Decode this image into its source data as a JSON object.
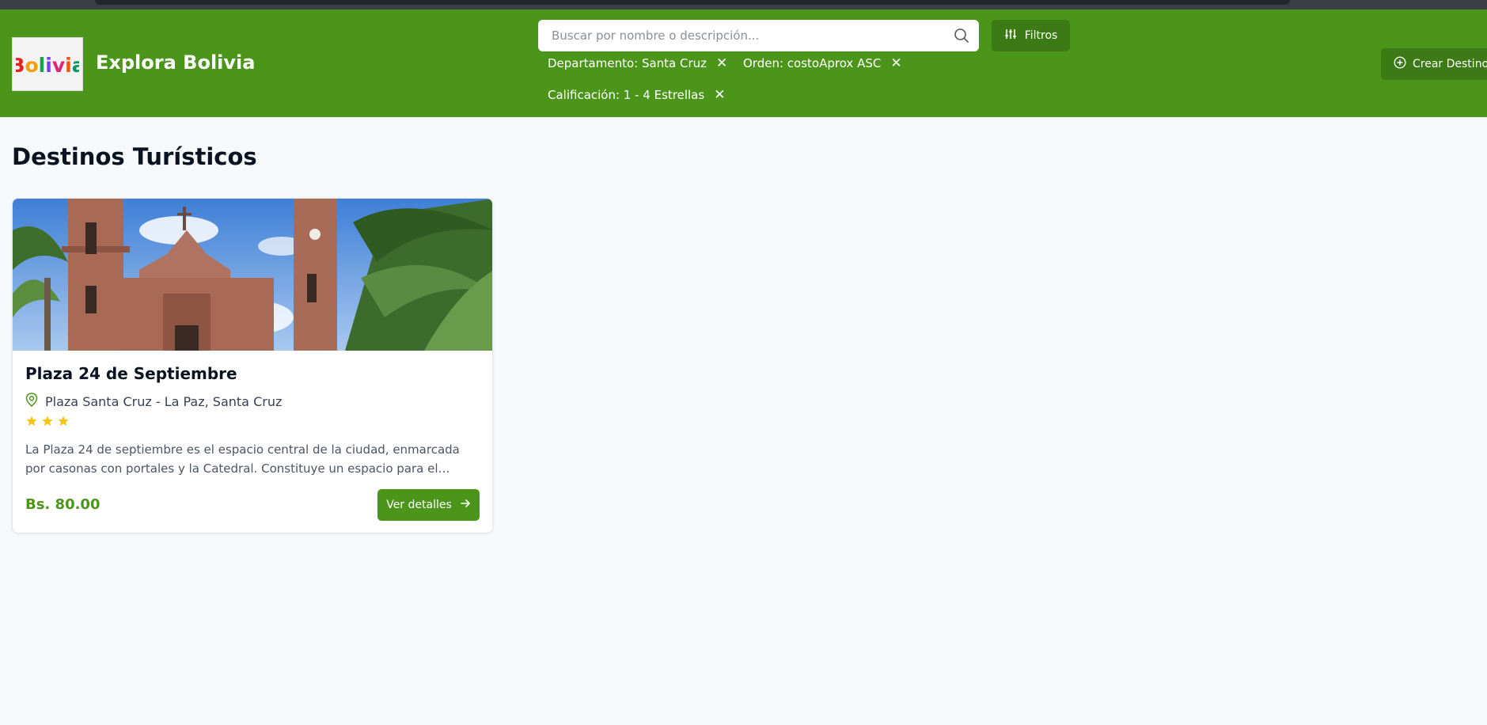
{
  "header": {
    "logo_text": "Bolivia",
    "brand_title": "Explora Bolivia",
    "search": {
      "placeholder": "Buscar por nombre o descripción..."
    },
    "filters_label": "Filtros",
    "active_filters": [
      {
        "label": "Departamento: Santa Cruz"
      },
      {
        "label": "Orden: costoAprox ASC"
      },
      {
        "label": "Calificación: 1 - 4 Estrellas"
      }
    ],
    "create_label": "Crear Destino"
  },
  "main": {
    "page_title": "Destinos Turísticos",
    "destinations": [
      {
        "name": "Plaza 24 de Septiembre",
        "location": "Plaza Santa Cruz - La Paz, Santa Cruz",
        "rating": 3,
        "description": "La Plaza 24 de septiembre es el espacio central de la ciudad, enmarcada por casonas con portales y la Catedral. Constituye un espacio para el esparcimiento...",
        "price": "Bs. 80.00",
        "details_label": "Ver detalles",
        "image": "cathedral-plaza-photo"
      }
    ]
  },
  "icons": {
    "search": "search-icon",
    "filters": "sliders-icon",
    "remove": "close-icon",
    "create": "plus-circle-icon",
    "location": "map-pin-icon",
    "star": "star-icon",
    "arrow": "arrow-right-icon"
  },
  "colors": {
    "header_bg": "#4c951b",
    "button_dark": "#3b7a15",
    "accent": "#4c951b",
    "star": "#f5c518",
    "page_bg": "#f7f8fa"
  }
}
